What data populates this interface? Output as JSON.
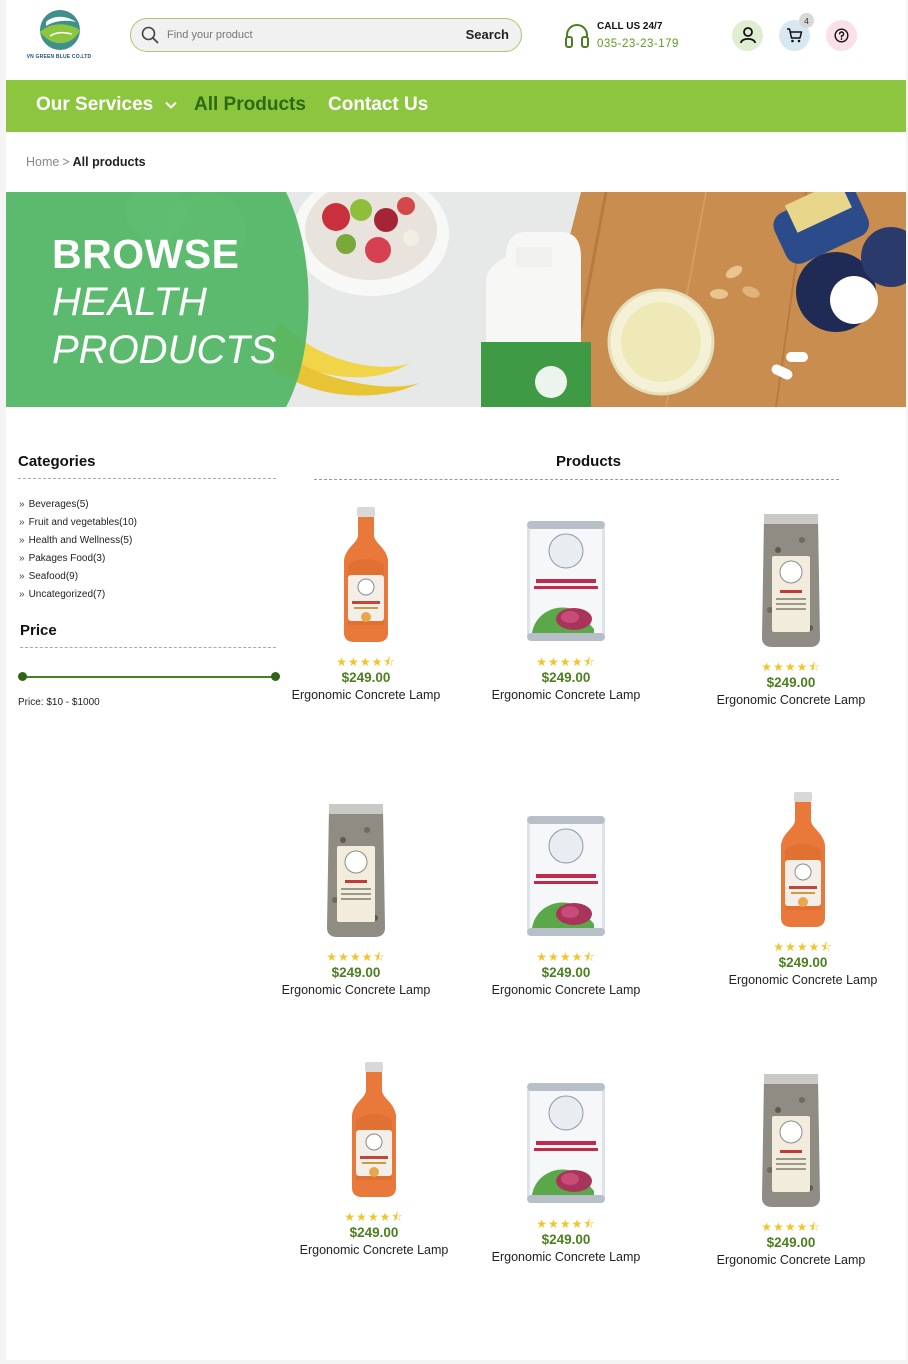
{
  "brand": {
    "logo_text": "VN GREEN BLUE CO.LTD"
  },
  "search": {
    "placeholder": "Find your product",
    "button_label": "Search"
  },
  "contact": {
    "label": "CALL US 24/7",
    "phone": "035-23-23-179"
  },
  "cart": {
    "count": "4"
  },
  "nav": {
    "services": "Our Services",
    "products": "All Products",
    "contact": "Contact Us"
  },
  "breadcrumb": {
    "home": "Home",
    "separator": ">",
    "current": "All products"
  },
  "banner": {
    "line1": "BROWSE",
    "line2": "HEALTH",
    "line3": "PRODUCTS"
  },
  "sidebar": {
    "categories_title": "Categories",
    "categories": [
      {
        "label": "Beverages(5)"
      },
      {
        "label": "Fruit and vegetables(10)"
      },
      {
        "label": "Health and Wellness(5)"
      },
      {
        "label": "Pakages Food(3)"
      },
      {
        "label": "Seafood(9)"
      },
      {
        "label": "Uncategorized(7)"
      }
    ],
    "price_title": "Price",
    "price_range": "Price: $10 - $1000",
    "price_min": 10,
    "price_max": 1000
  },
  "products": {
    "title": "Products",
    "items": [
      {
        "image": "juice-bottle",
        "rating": 4.5,
        "price": "$249.00",
        "name": "Ergonomic Concrete Lamp"
      },
      {
        "image": "banana-blossom-can",
        "rating": 4.5,
        "price": "$249.00",
        "name": "Ergonomic Concrete Lamp"
      },
      {
        "image": "hemp-seed-bag",
        "rating": 4.5,
        "price": "$249.00",
        "name": "Ergonomic Concrete Lamp"
      },
      {
        "image": "hemp-seed-bag",
        "rating": 4.5,
        "price": "$249.00",
        "name": "Ergonomic Concrete Lamp"
      },
      {
        "image": "banana-blossom-can",
        "rating": 4.5,
        "price": "$249.00",
        "name": "Ergonomic Concrete Lamp"
      },
      {
        "image": "juice-bottle",
        "rating": 4.5,
        "price": "$249.00",
        "name": "Ergonomic Concrete Lamp"
      },
      {
        "image": "juice-bottle",
        "rating": 4.5,
        "price": "$249.00",
        "name": "Ergonomic Concrete Lamp"
      },
      {
        "image": "banana-blossom-can",
        "rating": 4.5,
        "price": "$249.00",
        "name": "Ergonomic Concrete Lamp"
      },
      {
        "image": "hemp-seed-bag",
        "rating": 4.5,
        "price": "$249.00",
        "name": "Ergonomic Concrete Lamp"
      }
    ]
  },
  "colors": {
    "accent_green": "#8cc63f",
    "dark_green": "#4c7f1f",
    "star": "#f2c42b"
  }
}
